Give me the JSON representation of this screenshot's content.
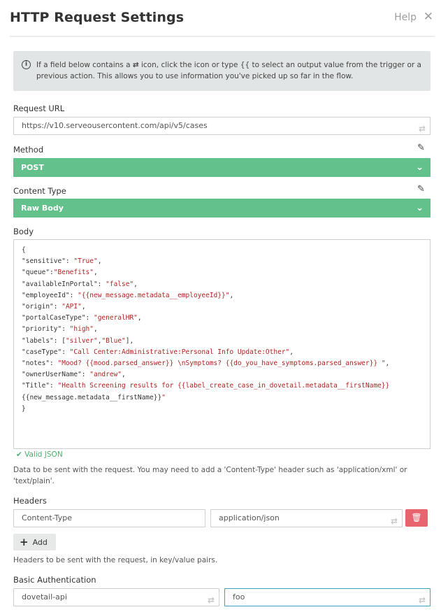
{
  "header": {
    "title": "HTTP Request Settings",
    "help_label": "Help",
    "close_glyph": "✕"
  },
  "info": {
    "text_before": "If a field below contains a ",
    "icon_glyph": "⇄",
    "text_after": " icon, click the icon or type {{ to select an output value from the trigger or a previous action. This allows you to use information you've picked up so far in the flow."
  },
  "request_url": {
    "label": "Request URL",
    "value": "https://v10.serveousercontent.com/api/v5/cases"
  },
  "method": {
    "label": "Method",
    "value": "POST"
  },
  "content_type": {
    "label": "Content Type",
    "value": "Raw Body"
  },
  "body": {
    "label": "Body",
    "lines": [
      "{",
      "\"sensitive\": \"True\",",
      "\"queue\":\"Benefits\",",
      "\"availableInPortal\": \"false\",",
      "\"employeeId\": \"{{new_message.metadata__employeeId}}\",",
      "\"origin\": \"API\",",
      "\"portalCaseType\": \"generalHR\",",
      "\"priority\": \"high\",",
      "\"labels\": [\"silver\",\"Blue\"],",
      "\"caseType\": \"Call Center:Administrative:Personal Info Update:Other\",",
      "\"notes\": \"Mood? {{mood.parsed_answer}} \\nSymptoms? {{do_you_have_symptoms.parsed_answer}} \",",
      "\"ownerUserName\": \"andrew\",",
      "\"Title\": \"Health Screening results for {{label_create_case_in_dovetail.metadata__firstName}}",
      "{{new_message.metadata__firstName}}\"",
      "}"
    ],
    "valid_label": "Valid JSON",
    "help_line1": "Data to be sent with the request. You may need to add a 'Content-Type' header such as 'application/xml' or",
    "help_line2": "'text/plain'."
  },
  "headers": {
    "label": "Headers",
    "key": "Content-Type",
    "value": "application/json",
    "add_label": "Add",
    "help": "Headers to be sent with the request, in key/value pairs."
  },
  "basic_auth": {
    "label": "Basic Authentication",
    "username": "dovetail-api",
    "password": "foo"
  },
  "colors": {
    "accent_green": "#63c28b",
    "danger": "#e8656f",
    "focus": "#3aa6b9"
  }
}
